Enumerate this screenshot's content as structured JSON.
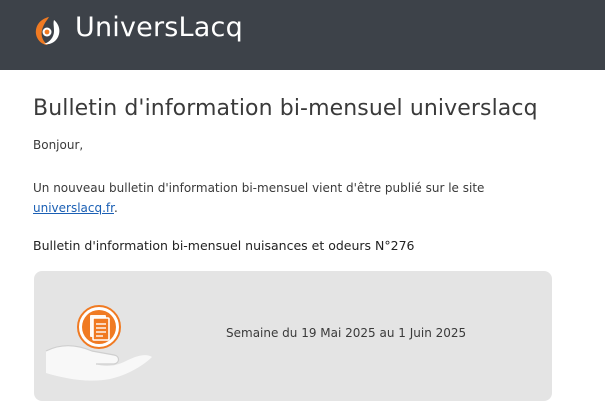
{
  "header": {
    "brand": "UniversLacq",
    "brand_color": "#3d4249",
    "accent_color": "#f07a22"
  },
  "content": {
    "title": "Bulletin d'information bi-mensuel universlacq",
    "greeting": "Bonjour,",
    "intro_text": "Un nouveau bulletin d'information bi-mensuel vient d'être publié sur le site",
    "link_text": "universlacq.fr",
    "link_suffix": ".",
    "bulletin_title": "Bulletin d'information bi-mensuel nuisances et odeurs N°276"
  },
  "card": {
    "icon": "document-hand-icon",
    "week_text": "Semaine du 19 Mai 2025 au 1 Juin 2025"
  }
}
